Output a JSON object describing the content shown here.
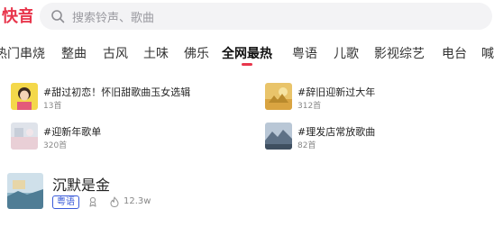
{
  "app": {
    "logo_text": "快音",
    "brand_color": "#e8364c"
  },
  "search": {
    "placeholder": "搜索铃声、歌曲",
    "icon": "search-icon"
  },
  "tabs": [
    {
      "label": "热门串烧",
      "active": false
    },
    {
      "label": "整曲",
      "active": false
    },
    {
      "label": "古风",
      "active": false
    },
    {
      "label": "土味",
      "active": false
    },
    {
      "label": "佛乐",
      "active": false
    },
    {
      "label": "全网最热",
      "active": true
    },
    {
      "label": "粤语",
      "active": false
    },
    {
      "label": "儿歌",
      "active": false
    },
    {
      "label": "影视综艺",
      "active": false
    },
    {
      "label": "电台",
      "active": false
    },
    {
      "label": "喊",
      "active": false
    }
  ],
  "playlists": [
    {
      "title": "#甜过初恋！怀旧甜歌曲玉女选辑",
      "count": "13首"
    },
    {
      "title": "#辞旧迎新过大年",
      "count": "312首"
    },
    {
      "title": "#迎新年歌单",
      "count": "320首"
    },
    {
      "title": "#理发店常放歌曲",
      "count": "82首"
    }
  ],
  "song": {
    "title": "沉默是金",
    "tag": "粤语",
    "heat": "12.3w",
    "tag_color": "#3a5bd9"
  }
}
